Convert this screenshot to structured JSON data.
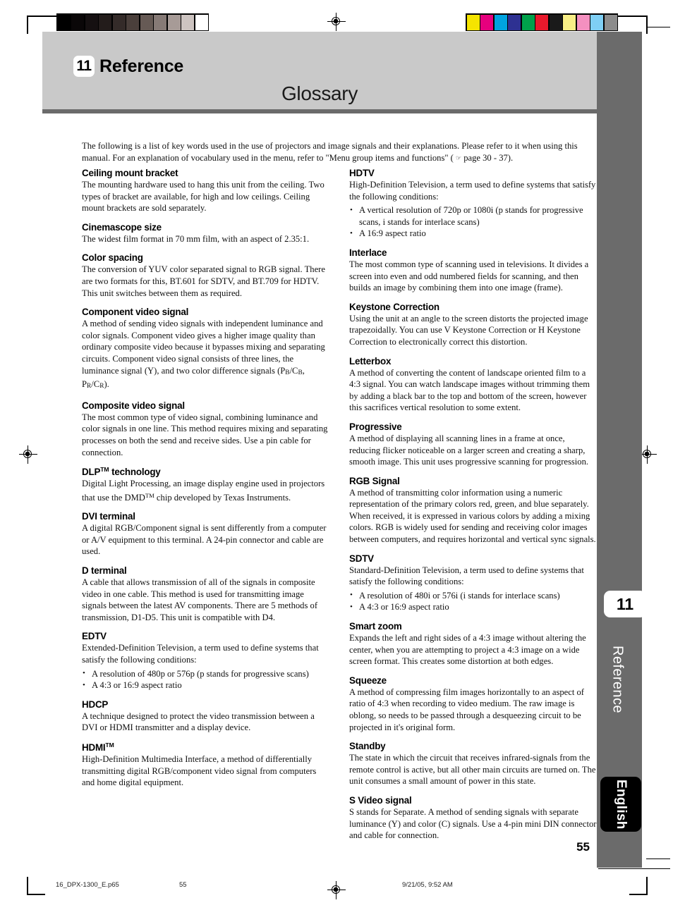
{
  "header": {
    "chapter_number": "11",
    "chapter_title": "Reference",
    "page_heading": "Glossary"
  },
  "intro": {
    "text_before_icon": "The following is a list of key words used in the use of projectors and image signals and their explanations. Please refer to it when using this manual. For an explanation of vocabulary used in the menu, refer to \"Menu group items and functions\" ( ",
    "icon": "pointing-hand-icon",
    "icon_glyph": "☞",
    "text_after_icon": " page 30 - 37)."
  },
  "left_column": [
    {
      "term": "Ceiling mount bracket",
      "definition": "The mounting hardware used to hang this unit from the ceiling. Two types of bracket are available, for high and low ceilings. Ceiling mount brackets are sold separately."
    },
    {
      "term": "Cinemascope size",
      "definition": "The widest film format in 70 mm film, with an aspect of 2.35:1."
    },
    {
      "term": "Color spacing",
      "definition": "The conversion of YUV color separated signal to RGB signal. There are two formats for this, BT.601 for SDTV, and BT.709 for HDTV. This unit switches between them as required."
    },
    {
      "term": "Component video signal",
      "definition": "A method of sending video signals with independent luminance and color signals. Component video gives a higher image quality than ordinary composite video because it bypasses mixing and separating circuits. Component video signal consists of three lines, the luminance signal (Y), and two color difference signals (P",
      "definition_sub1": "B",
      "definition_mid1": "/C",
      "definition_sub2": "B",
      "definition_mid2": ", P",
      "definition_sub3": "R",
      "definition_mid3": "/C",
      "definition_sub4": "R",
      "definition_end": ")."
    },
    {
      "term": "Composite video signal",
      "definition": "The most common type of video signal, combining luminance and color signals in one line. This method requires mixing and separating processes on both the send and receive sides. Use a pin cable for connection."
    },
    {
      "term": "DLP",
      "term_tm": "TM",
      "term_tail": " technology",
      "definition_a": "Digital Light Processing, an image display engine used in projectors that use the DMD",
      "definition_tm": "TM",
      "definition_b": " chip developed by Texas Instruments."
    },
    {
      "term": "DVI terminal",
      "definition": "A digital RGB/Component signal is sent differently from a computer or A/V equipment to this terminal. A 24-pin connector and cable are used."
    },
    {
      "term": "D terminal",
      "definition": "A cable that allows transmission of all of the signals in composite video in one cable. This method is used for transmitting image signals between the latest AV components. There are 5 methods of transmission, D1-D5. This unit is compatible with D4."
    },
    {
      "term": "EDTV",
      "definition": "Extended-Definition Television, a term used to define systems that satisfy the following conditions:",
      "bullets": [
        "A resolution of 480p or 576p (p stands for progressive scans)",
        "A 4:3 or 16:9 aspect ratio"
      ]
    },
    {
      "term": "HDCP",
      "definition": "A technique designed to protect the video transmission between a DVI or HDMI transmitter and a display device."
    },
    {
      "term": "HDMI",
      "term_tm": "TM",
      "definition": "High-Definition Multimedia Interface, a method of differentially transmitting digital RGB/component video signal from computers and home digital equipment."
    }
  ],
  "right_column": [
    {
      "term": "HDTV",
      "definition": "High-Definition Television, a term used to define systems that satisfy the following conditions:",
      "bullets": [
        "A vertical resolution of 720p or 1080i (p stands for progressive scans, i stands for interlace scans)",
        "A 16:9 aspect ratio"
      ]
    },
    {
      "term": "Interlace",
      "definition": "The most common type of scanning used in televisions. It divides a screen into even and odd numbered fields for scanning, and then builds an image by combining them into one image (frame)."
    },
    {
      "term": "Keystone Correction",
      "definition": "Using the unit at an angle to the screen distorts the projected image trapezoidally. You can use V Keystone Correction or H Keystone Correction to electronically correct this distortion."
    },
    {
      "term": "Letterbox",
      "definition": "A method of converting the content of landscape oriented film to a 4:3 signal. You can watch landscape images without trimming them by adding a black bar to the top and bottom of the screen, however this sacrifices vertical resolution to some extent."
    },
    {
      "term": "Progressive",
      "definition": "A method of displaying all scanning lines in a frame at once, reducing flicker noticeable on a larger screen and creating a sharp, smooth image. This unit uses progressive scanning for progression."
    },
    {
      "term": "RGB Signal",
      "definition": "A method of transmitting color information using a numeric representation of the primary colors red, green, and blue separately. When received, it is expressed in various colors by adding a mixing colors. RGB is widely used for sending and receiving color images between computers, and requires horizontal and vertical sync signals."
    },
    {
      "term": "SDTV",
      "definition": "Standard-Definition Television, a term used to define systems that satisfy the following conditions:",
      "bullets": [
        "A resolution of 480i or 576i (i stands for interlace scans)",
        "A 4:3 or 16:9 aspect ratio"
      ]
    },
    {
      "term": "Smart zoom",
      "definition": "Expands the left and right sides of a 4:3 image without altering the center, when you are attempting to project a 4:3 image on a wide screen format. This creates some distortion at both edges."
    },
    {
      "term": "Squeeze",
      "definition": "A method of compressing film images horizontally to an aspect of ratio of 4:3 when recording to video medium. The raw image is oblong, so needs to be passed through a desqueezing circuit to be projected in it's original form."
    },
    {
      "term": "Standby",
      "definition": "The state in which the circuit that receives infrared-signals from the remote control is active, but all other main circuits are turned on. The unit consumes a small amount of power in this state."
    },
    {
      "term": "S Video signal",
      "definition": "S stands for Separate. A method of sending signals with separate luminance (Y) and color (C) signals. Use a 4-pin mini DIN connector and cable for connection."
    }
  ],
  "side_rail": {
    "chapter_number": "11",
    "chapter_label": "Reference",
    "language_label": "English"
  },
  "footer": {
    "page_number": "55",
    "file_name": "16_DPX-1300_E.p65",
    "page_marker": "55",
    "timestamp": "9/21/05, 9:52 AM"
  },
  "print_strips": {
    "grayscale": [
      "#000000",
      "#0a0708",
      "#151011",
      "#231c1b",
      "#342b29",
      "#4a3f3b",
      "#665a55",
      "#867a76",
      "#a79b97",
      "#cdc4c1",
      "#ffffff"
    ],
    "color": [
      "#f5e400",
      "#e6007e",
      "#00a3e0",
      "#2e3192",
      "#00a14b",
      "#e8192c",
      "#1a1a1a",
      "#f8ee86",
      "#f490c0",
      "#7fcff4",
      "#8c8c8c"
    ]
  }
}
